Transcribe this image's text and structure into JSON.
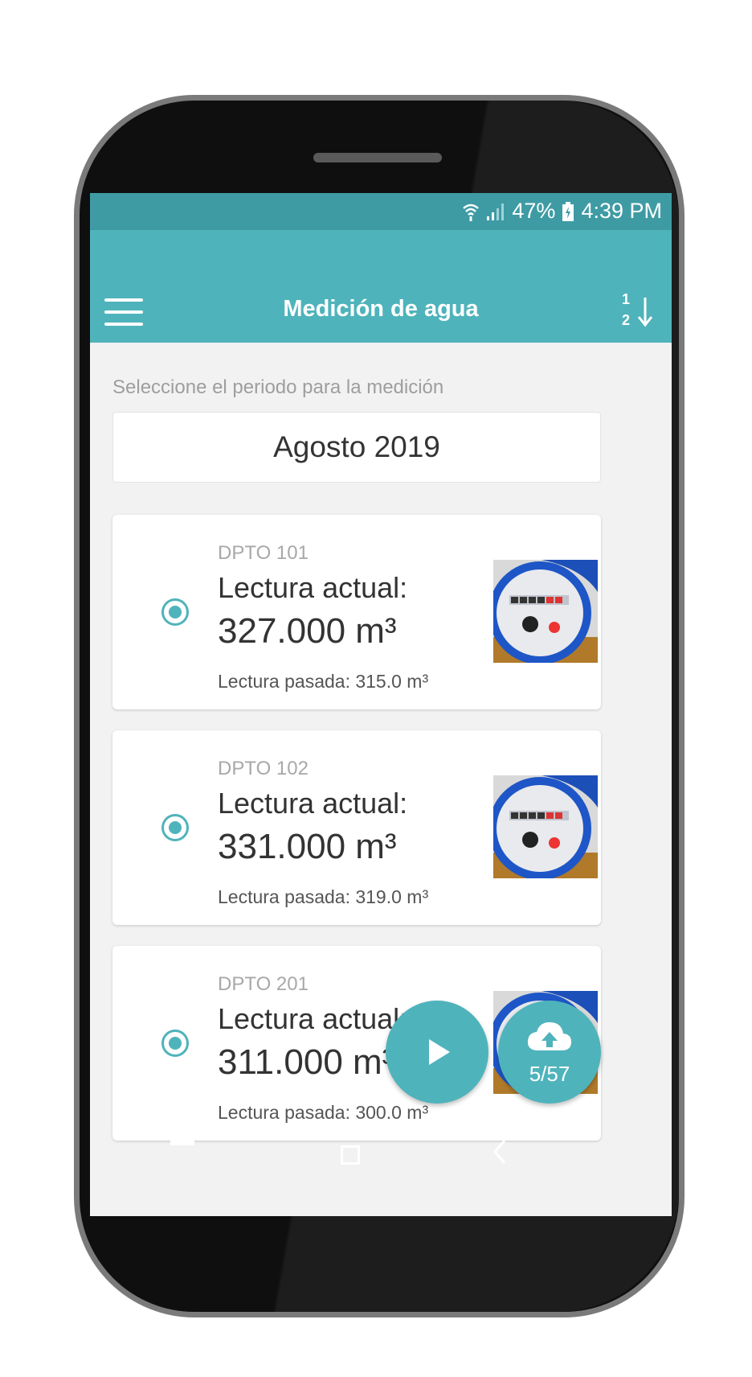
{
  "status_bar": {
    "battery": "47%",
    "time": "4:39 PM"
  },
  "app_bar": {
    "title": "Medición de agua",
    "sort_top": "1",
    "sort_bottom": "2"
  },
  "period": {
    "label": "Seleccione el periodo para la medición",
    "selected": "Agosto 2019"
  },
  "readings": [
    {
      "dpto": "DPTO 101",
      "label": "Lectura actual:",
      "value": "327.000 m³",
      "previous": "Lectura pasada: 315.0 m³"
    },
    {
      "dpto": "DPTO 102",
      "label": "Lectura actual:",
      "value": "331.000 m³",
      "previous": "Lectura pasada: 319.0 m³"
    },
    {
      "dpto": "DPTO 201",
      "label": "Lectura actual:",
      "value": "311.000 m³",
      "previous": "Lectura pasada: 300.0 m³"
    }
  ],
  "upload": {
    "count": "5/57"
  },
  "colors": {
    "accent": "#4fb3bb",
    "status_bar": "#3e9ba4",
    "background": "#f2f2f2"
  },
  "icons": [
    "wifi-icon",
    "signal-icon",
    "battery-icon",
    "menu-icon",
    "sort-numeric-icon",
    "radio-selected-icon",
    "play-icon",
    "cloud-upload-icon",
    "nav-recent-icon",
    "nav-home-icon",
    "nav-back-icon"
  ]
}
